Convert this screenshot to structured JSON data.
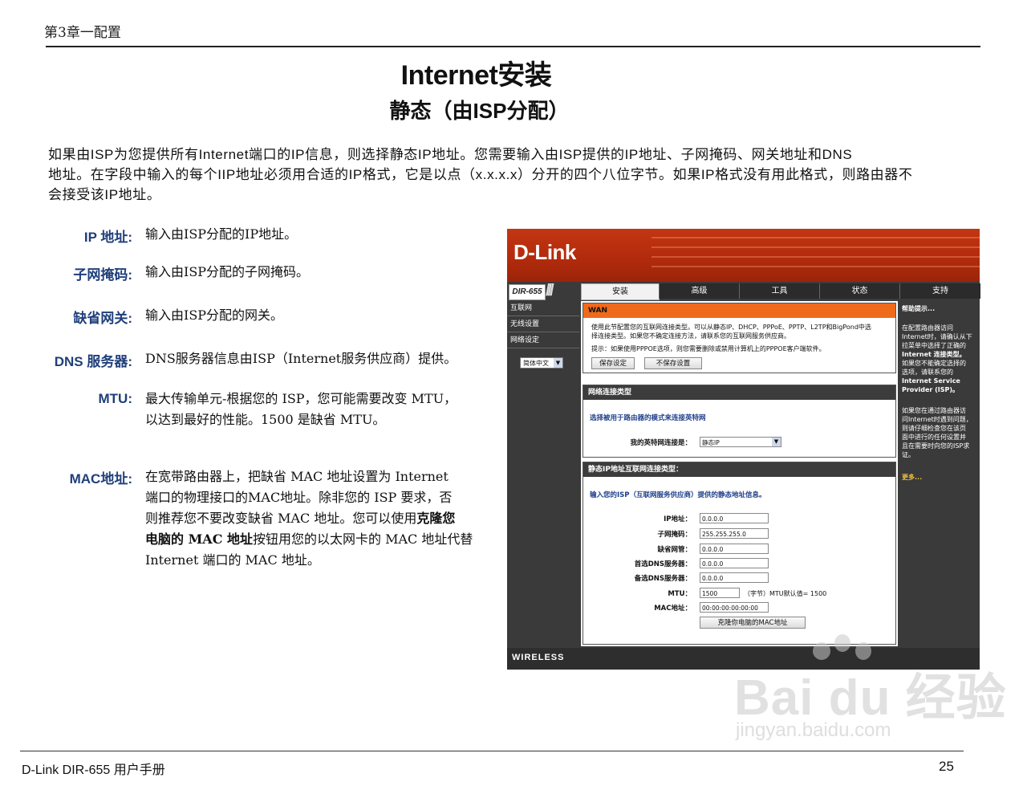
{
  "header": {
    "chapter": "第3章一配置"
  },
  "title": "Internet安装",
  "subtitle": "静态（由ISP分配）",
  "intro": [
    "如果由ISP为您提供所有Internet端口的IP信息，则选择静态IP地址。您需要输入由ISP提供的IP地址、子网掩码、网关地址和DNS",
    "地址。在字段中输入的每个IIP地址必须用合适的IP格式，它是以点（x.x.x.x）分开的四个八位字节。如果IP格式没有用此格式，则路由器不",
    "会接受该IP地址。"
  ],
  "definitions": {
    "ip": {
      "label": "IP 地址:",
      "text": "输入由ISP分配的IP地址。"
    },
    "mask": {
      "label": "子网掩码:",
      "text": "输入由ISP分配的子网掩码。"
    },
    "gateway": {
      "label": "缺省网关:",
      "text": "输入由ISP分配的网关。"
    },
    "dns": {
      "label": "DNS 服务器:",
      "text": "DNS服务器信息由ISP（Internet服务供应商）提供。"
    },
    "mtu": {
      "label": "MTU:",
      "line1": "最大传输单元-根据您的 ISP，您可能需要改变 MTU，",
      "line2": "以达到最好的性能。1500 是缺省 MTU。"
    },
    "mac": {
      "label": "MAC地址:",
      "line1": "在宽带路由器上，把缺省 MAC 地址设置为 Internet",
      "line2": "端口的物理接口的MAC地址。除非您的 ISP 要求，否",
      "line3a": "则推荐您不要改变缺省 MAC 地址。您可以使用",
      "line3b": "克隆您",
      "line4a": "电脑的 MAC 地址",
      "line4b": "按钮用您的以太网卡的 MAC 地址代替",
      "line5": "Internet 端口的 MAC 地址。"
    }
  },
  "router": {
    "logo": "D-Link",
    "model": "DIR-655",
    "tabs": [
      "安装",
      "高级",
      "工具",
      "状态",
      "支持"
    ],
    "nav": [
      "互联网",
      "无线设置",
      "网络设定"
    ],
    "language": "简体中文",
    "wan": {
      "header": "WAN",
      "text1": "使用此节配置您的互联网连接类型。可以从静态IP、DHCP、PPPoE、PPTP、L2TP和BigPond中选",
      "text2": "择连接类型。如果您不确定连接方法，请联系您的互联网服务供应商。",
      "text3": "提示：如果使用PPPOE选项，则您需要删除或禁用计算机上的PPPOE客户端软件。",
      "save": "保存设定",
      "nosave": "不保存设置"
    },
    "conn": {
      "header": "网络连接类型",
      "prompt": "选择被用于路由器的模式来连接英特网",
      "label": "我的英特网连接是：",
      "value": "静态IP"
    },
    "static": {
      "header": "静态IP地址互联网连接类型：",
      "prompt": "输入您的ISP（互联网服务供应商）提供的静态地址信息。",
      "fields": [
        {
          "label": "IP地址：",
          "value": "0.0.0.0"
        },
        {
          "label": "子网掩码：",
          "value": "255.255.255.0"
        },
        {
          "label": "缺省网管：",
          "value": "0.0.0.0"
        },
        {
          "label": "首选DNS服务器：",
          "value": "0.0.0.0"
        },
        {
          "label": "备选DNS服务器：",
          "value": "0.0.0.0"
        }
      ],
      "mtu_label": "MTU：",
      "mtu_value": "1500",
      "mtu_note": "（字节）MTU默认值= 1500",
      "mac_label": "MAC地址：",
      "mac_value": "00:00:00:00:00:00",
      "clone": "克隆你电脑的MAC地址"
    },
    "help": {
      "title": "帮助提示...",
      "p1": [
        "在配置路由器访问",
        "Internet时，请确认从下",
        "拉菜单中选择了正确的"
      ],
      "p1_bold": [
        "Internet 连接类型。"
      ],
      "p1b": [
        "如果您不能确定选择的",
        "选项，请联系您的"
      ],
      "p1_bold2": [
        "Internet Service",
        "Provider (ISP)。"
      ],
      "p2": [
        "如果您在通过路由器访",
        "问Internet时遇到问题，",
        "则请仔细检查您在该页",
        "面中进行的任何设置并",
        "且在需要时向您的ISP求",
        "证。"
      ],
      "more": "更多..."
    },
    "footer": "WIRELESS"
  },
  "watermark": {
    "brand": "Bai du 经验",
    "url": "jingyan.baidu.com"
  },
  "footer": {
    "left": "D-Link DIR-655 用户手册",
    "page": "25"
  }
}
